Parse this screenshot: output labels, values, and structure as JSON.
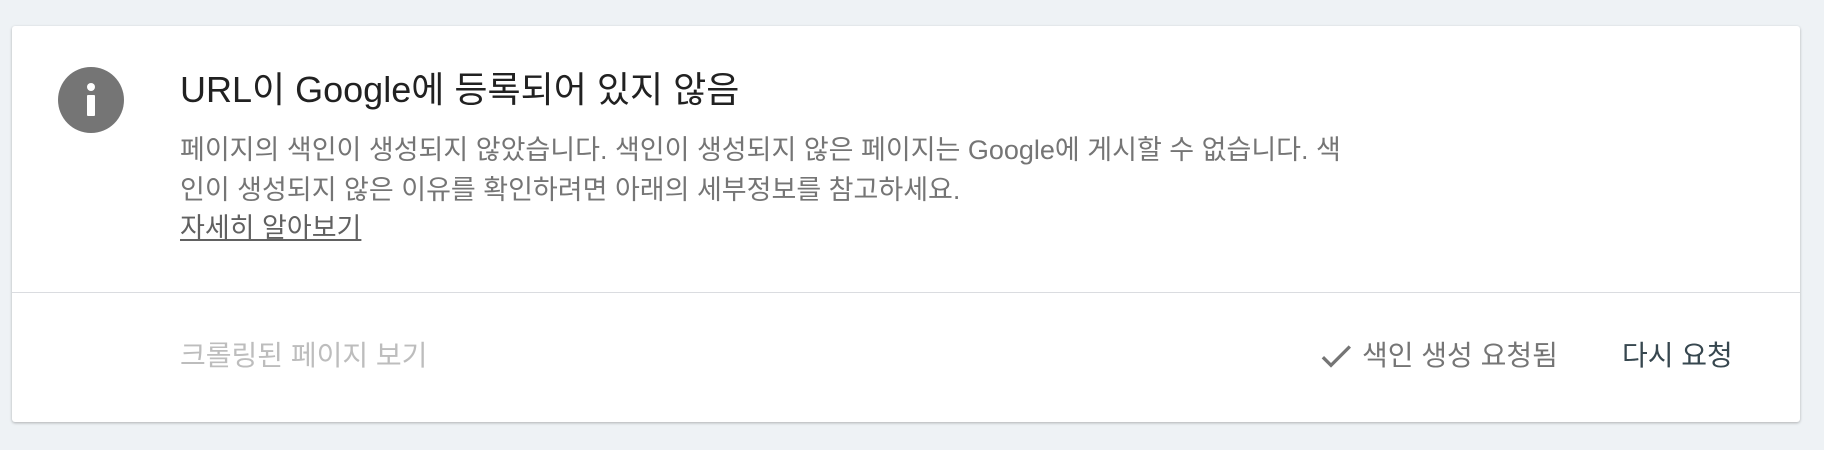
{
  "status": {
    "icon": "info-icon",
    "title": "URL이 Google에 등록되어 있지 않음",
    "description": "페이지의 색인이 생성되지 않았습니다. 색인이 생성되지 않은 페이지는 Google에 게시할 수 없습니다. 색인이 생성되지 않은 이유를 확인하려면 아래의 세부정보를 참고하세요.",
    "learn_more_label": "자세히 알아보기"
  },
  "footer": {
    "view_crawled_label": "크롤링된 페이지 보기",
    "requested_icon": "check-icon",
    "requested_label": "색인 생성 요청됨",
    "request_again_label": "다시 요청"
  },
  "colors": {
    "background": "#eef2f5",
    "card": "#ffffff",
    "icon": "#757575",
    "title": "#212121",
    "muted": "#757575",
    "disabled": "#bdbdbd",
    "action": "#37474f"
  }
}
